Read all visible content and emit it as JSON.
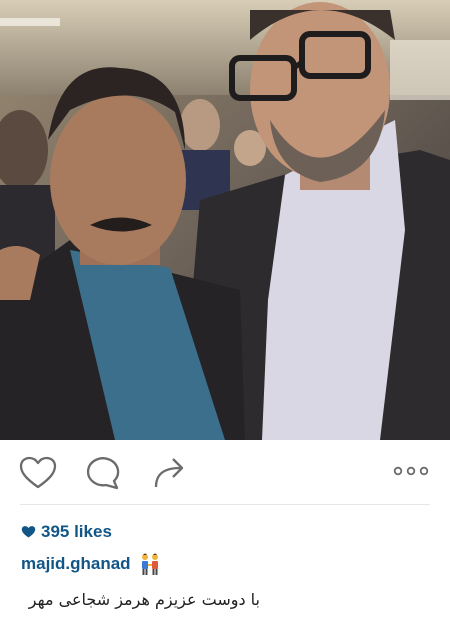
{
  "post": {
    "photo_alt": "",
    "likes_count": "395 likes",
    "username": "majid.ghanad",
    "caption": "با دوست عزیزم هرمز شجاعی مهر"
  },
  "icons": {
    "like": "heart-outline-icon",
    "comment": "speech-bubble-icon",
    "share": "share-arrow-icon",
    "more": "ellipsis-icon",
    "likes": "heart-filled-icon",
    "emoji": "two-people-holding-hands-emoji"
  },
  "colors": {
    "link": "#125688",
    "icon": "#6b6b6b",
    "divider": "#e6e6e6"
  }
}
